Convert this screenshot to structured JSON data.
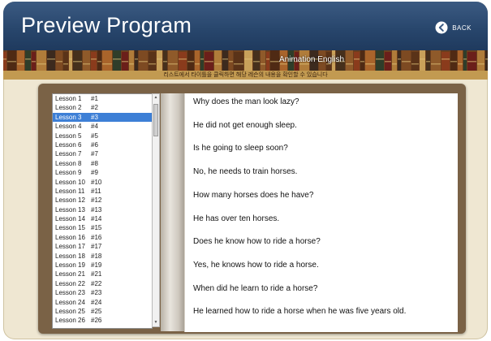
{
  "header": {
    "title": "Preview Program",
    "back_label": "BACK",
    "back_icon": "left-arrow-circle-icon"
  },
  "banner": {
    "label": "Animation English",
    "notice": "리스트에서 타이틀을 클릭하면 해당 레슨의 내용을 확인할 수 있습니다"
  },
  "lessons": [
    {
      "name": "Lesson 1",
      "num": "#1"
    },
    {
      "name": "Lesson 2",
      "num": "#2"
    },
    {
      "name": "Lesson 3",
      "num": "#3",
      "selected": true
    },
    {
      "name": "Lesson 4",
      "num": "#4"
    },
    {
      "name": "Lesson 5",
      "num": "#5"
    },
    {
      "name": "Lesson 6",
      "num": "#6"
    },
    {
      "name": "Lesson 7",
      "num": "#7"
    },
    {
      "name": "Lesson 8",
      "num": "#8"
    },
    {
      "name": "Lesson 9",
      "num": "#9"
    },
    {
      "name": "Lesson 10",
      "num": "#10"
    },
    {
      "name": "Lesson 11",
      "num": "#11"
    },
    {
      "name": "Lesson 12",
      "num": "#12"
    },
    {
      "name": "Lesson 13",
      "num": "#13"
    },
    {
      "name": "Lesson 14",
      "num": "#14"
    },
    {
      "name": "Lesson 15",
      "num": "#15"
    },
    {
      "name": "Lesson 16",
      "num": "#16"
    },
    {
      "name": "Lesson 17",
      "num": "#17"
    },
    {
      "name": "Lesson 18",
      "num": "#18"
    },
    {
      "name": "Lesson 19",
      "num": "#19"
    },
    {
      "name": "Lesson 21",
      "num": "#21"
    },
    {
      "name": "Lesson 22",
      "num": "#22"
    },
    {
      "name": "Lesson 23",
      "num": "#23"
    },
    {
      "name": "Lesson 24",
      "num": "#24"
    },
    {
      "name": "Lesson 25",
      "num": "#25"
    },
    {
      "name": "Lesson 26",
      "num": "#26"
    }
  ],
  "content": {
    "sentences": [
      "Why does the man look lazy?",
      "He did not get enough sleep.",
      "Is he going to sleep soon?",
      "No, he needs to train horses.",
      "How many horses does he have?",
      "He has over ten horses.",
      "Does he know how to ride a horse?",
      "Yes, he knows how to ride a horse.",
      "When did he learn to ride a horse?",
      "He learned how to ride a horse when he was five years old."
    ]
  },
  "colors": {
    "header": "#27456b",
    "selection": "#3d7fd6",
    "book_border": "#7a6246",
    "notice_bar": "#c29a51"
  }
}
